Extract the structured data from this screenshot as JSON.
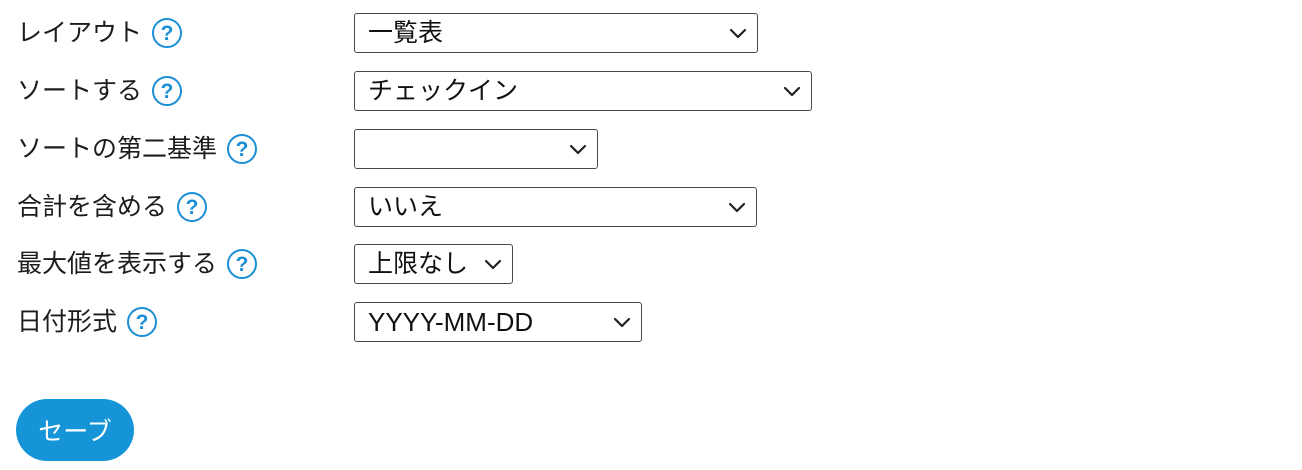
{
  "form": {
    "help_glyph": "?",
    "rows": [
      {
        "label": "レイアウト",
        "value": "一覧表"
      },
      {
        "label": "ソートする",
        "value": "チェックイン"
      },
      {
        "label": "ソートの第二基準",
        "value": ""
      },
      {
        "label": "合計を含める",
        "value": "いいえ"
      },
      {
        "label": "最大値を表示する",
        "value": "上限なし"
      },
      {
        "label": "日付形式",
        "value": "YYYY-MM-DD"
      }
    ],
    "save_label": "セーブ"
  },
  "colors": {
    "accent": "#1595d8",
    "help_icon": "#1a8fd6",
    "border": "#4a4a4a"
  },
  "icons": {
    "help": "help-icon",
    "dropdown": "chevron-down-icon"
  }
}
